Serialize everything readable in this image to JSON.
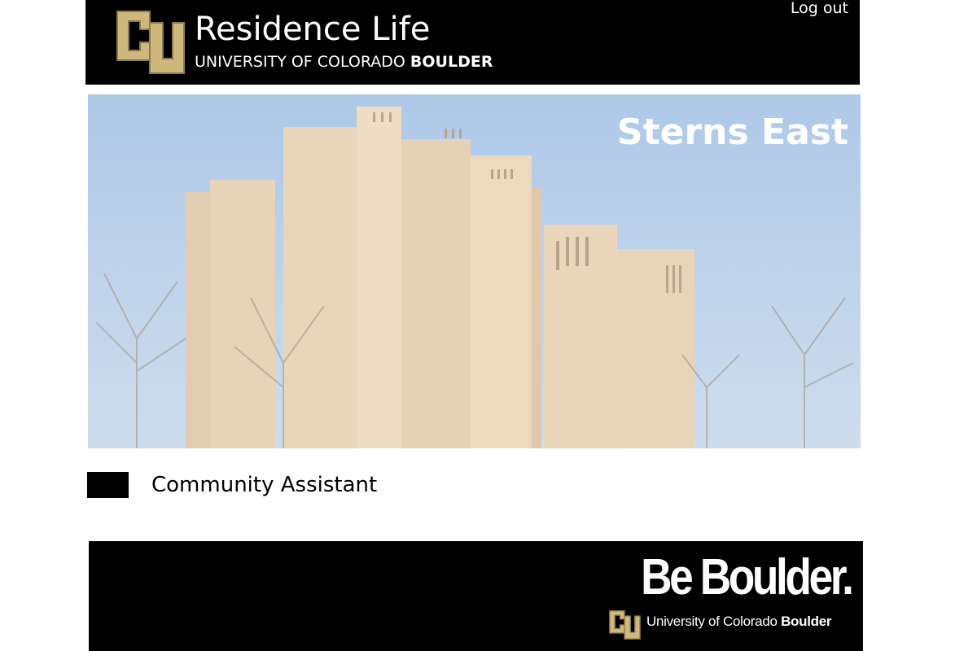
{
  "header": {
    "title": "Residence Life",
    "subtitle_prefix": "UNIVERSITY OF COLORADO ",
    "subtitle_bold": "BOULDER",
    "logout_label": "Log out"
  },
  "hero": {
    "title": "Sterns East"
  },
  "role": {
    "label": "Community Assistant"
  },
  "footer": {
    "slogan": "Be Boulder.",
    "university_prefix": "University of Colorado ",
    "university_bold": "Boulder"
  },
  "colors": {
    "header_bg": "#000000",
    "gold": "#CFB87C",
    "sky": "#9EBEE2",
    "building": "#E2C9A6"
  }
}
